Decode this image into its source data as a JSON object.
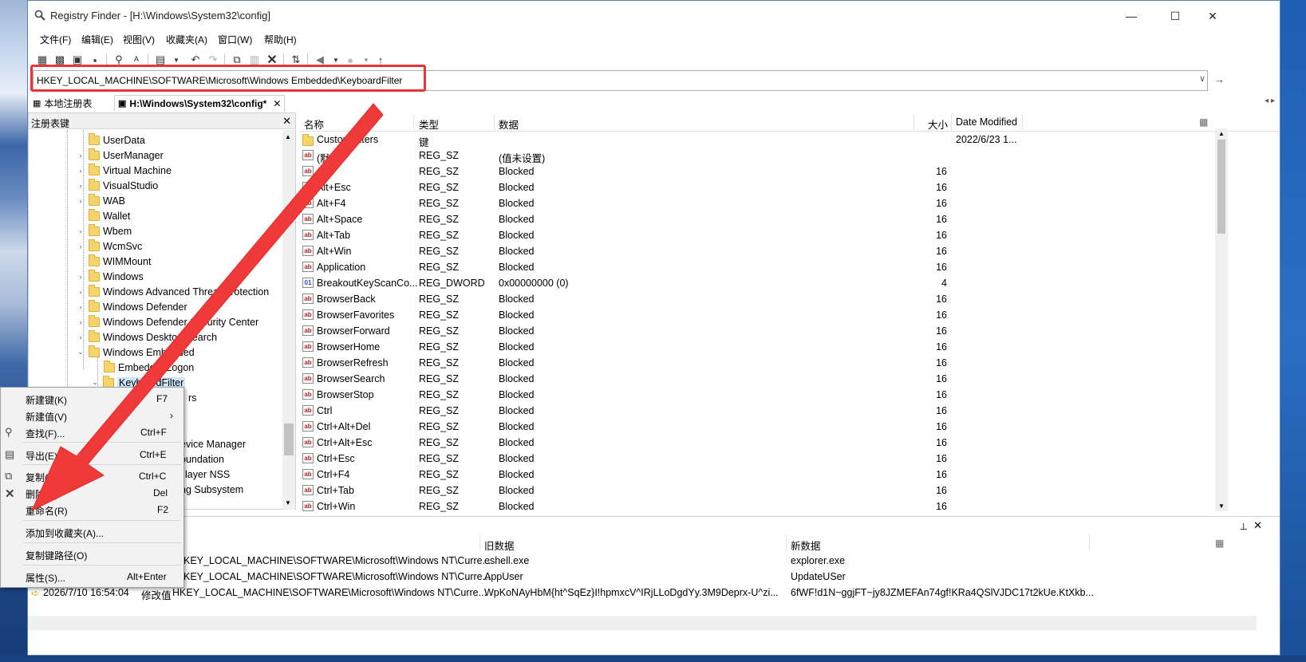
{
  "window": {
    "title": "Registry Finder - [H:\\Windows\\System32\\config]",
    "minimize": "—",
    "maximize": "☐",
    "close": "✕"
  },
  "menu": [
    "文件(F)",
    "编辑(E)",
    "视图(V)",
    "收藏夹(A)",
    "窗口(W)",
    "帮助(H)"
  ],
  "toolbar": {
    "icons": [
      "new-window-icon",
      "registry-icon",
      "hive-icon",
      "save-icon",
      "find-icon",
      "replace-icon",
      "export-icon",
      "undo-icon",
      "redo-icon",
      "copy-icon",
      "paste-icon",
      "delete-icon",
      "refresh-icon",
      "back-icon",
      "forward-icon",
      "up-icon"
    ]
  },
  "address": {
    "value": "HKEY_LOCAL_MACHINE\\SOFTWARE\\Microsoft\\Windows Embedded\\KeyboardFilter",
    "go": "→"
  },
  "doc_tabs": [
    {
      "label": "本地注册表"
    },
    {
      "label": "H:\\Windows\\System32\\config*"
    }
  ],
  "tree": {
    "header": "注册表键",
    "close": "✕",
    "items": [
      {
        "label": "UserData"
      },
      {
        "label": "UserManager"
      },
      {
        "label": "Virtual Machine"
      },
      {
        "label": "VisualStudio"
      },
      {
        "label": "WAB"
      },
      {
        "label": "Wallet"
      },
      {
        "label": "Wbem"
      },
      {
        "label": "WcmSvc"
      },
      {
        "label": "WIMMount"
      },
      {
        "label": "Windows"
      },
      {
        "label": "Windows Advanced Threat Protection"
      },
      {
        "label": "Windows Defender"
      },
      {
        "label": "Windows Defender Security Center"
      },
      {
        "label": "Windows Desktop Search"
      },
      {
        "label": "Windows Embedded"
      },
      {
        "label": "EmbeddedLogon"
      },
      {
        "label": "KeyboardFilter"
      },
      {
        "label": "rs"
      },
      {
        "label": "evice Manager"
      },
      {
        "label": "oundation"
      },
      {
        "label": "layer NSS"
      },
      {
        "label": "ng Subsystem"
      }
    ]
  },
  "list": {
    "columns": [
      "名称",
      "类型",
      "数据",
      "大小",
      "Date Modified"
    ],
    "rows": [
      {
        "name": "CustomFilters",
        "type": "键",
        "data": "",
        "size": "",
        "date": "2022/6/23 1...",
        "kind": "folder"
      },
      {
        "name": "(默认)",
        "type": "REG_SZ",
        "data": "(值未设置)",
        "size": "",
        "date": "",
        "kind": "sz"
      },
      {
        "name": "Alt",
        "type": "REG_SZ",
        "data": "Blocked",
        "size": "16",
        "date": "",
        "kind": "sz"
      },
      {
        "name": "Alt+Esc",
        "type": "REG_SZ",
        "data": "Blocked",
        "size": "16",
        "date": "",
        "kind": "sz"
      },
      {
        "name": "Alt+F4",
        "type": "REG_SZ",
        "data": "Blocked",
        "size": "16",
        "date": "",
        "kind": "sz"
      },
      {
        "name": "Alt+Space",
        "type": "REG_SZ",
        "data": "Blocked",
        "size": "16",
        "date": "",
        "kind": "sz"
      },
      {
        "name": "Alt+Tab",
        "type": "REG_SZ",
        "data": "Blocked",
        "size": "16",
        "date": "",
        "kind": "sz"
      },
      {
        "name": "Alt+Win",
        "type": "REG_SZ",
        "data": "Blocked",
        "size": "16",
        "date": "",
        "kind": "sz"
      },
      {
        "name": "Application",
        "type": "REG_SZ",
        "data": "Blocked",
        "size": "16",
        "date": "",
        "kind": "sz"
      },
      {
        "name": "BreakoutKeyScanCo...",
        "type": "REG_DWORD",
        "data": "0x00000000 (0)",
        "size": "4",
        "date": "",
        "kind": "dword"
      },
      {
        "name": "BrowserBack",
        "type": "REG_SZ",
        "data": "Blocked",
        "size": "16",
        "date": "",
        "kind": "sz"
      },
      {
        "name": "BrowserFavorites",
        "type": "REG_SZ",
        "data": "Blocked",
        "size": "16",
        "date": "",
        "kind": "sz"
      },
      {
        "name": "BrowserForward",
        "type": "REG_SZ",
        "data": "Blocked",
        "size": "16",
        "date": "",
        "kind": "sz"
      },
      {
        "name": "BrowserHome",
        "type": "REG_SZ",
        "data": "Blocked",
        "size": "16",
        "date": "",
        "kind": "sz"
      },
      {
        "name": "BrowserRefresh",
        "type": "REG_SZ",
        "data": "Blocked",
        "size": "16",
        "date": "",
        "kind": "sz"
      },
      {
        "name": "BrowserSearch",
        "type": "REG_SZ",
        "data": "Blocked",
        "size": "16",
        "date": "",
        "kind": "sz"
      },
      {
        "name": "BrowserStop",
        "type": "REG_SZ",
        "data": "Blocked",
        "size": "16",
        "date": "",
        "kind": "sz"
      },
      {
        "name": "Ctrl",
        "type": "REG_SZ",
        "data": "Blocked",
        "size": "16",
        "date": "",
        "kind": "sz"
      },
      {
        "name": "Ctrl+Alt+Del",
        "type": "REG_SZ",
        "data": "Blocked",
        "size": "16",
        "date": "",
        "kind": "sz"
      },
      {
        "name": "Ctrl+Alt+Esc",
        "type": "REG_SZ",
        "data": "Blocked",
        "size": "16",
        "date": "",
        "kind": "sz"
      },
      {
        "name": "Ctrl+Esc",
        "type": "REG_SZ",
        "data": "Blocked",
        "size": "16",
        "date": "",
        "kind": "sz"
      },
      {
        "name": "Ctrl+F4",
        "type": "REG_SZ",
        "data": "Blocked",
        "size": "16",
        "date": "",
        "kind": "sz"
      },
      {
        "name": "Ctrl+Tab",
        "type": "REG_SZ",
        "data": "Blocked",
        "size": "16",
        "date": "",
        "kind": "sz"
      },
      {
        "name": "Ctrl+Win",
        "type": "REG_SZ",
        "data": "Blocked",
        "size": "16",
        "date": "",
        "kind": "sz"
      }
    ]
  },
  "bottom": {
    "pin": "📌",
    "close": "✕",
    "columns": [
      "旧数据",
      "新数据"
    ],
    "rows": [
      {
        "time": "",
        "op": "",
        "key": "KEY_LOCAL_MACHINE\\SOFTWARE\\Microsoft\\Windows NT\\Curre...",
        "old": "eshell.exe",
        "new": "explorer.exe"
      },
      {
        "time": "",
        "op": "",
        "key": "KEY_LOCAL_MACHINE\\SOFTWARE\\Microsoft\\Windows NT\\Curre...",
        "old": "AppUser",
        "new": "UpdateUSer"
      },
      {
        "time": "2026/7/10 16:54:04",
        "op": "修改值",
        "key": "HKEY_LOCAL_MACHINE\\SOFTWARE\\Microsoft\\Windows NT\\Curre...",
        "old": "WpKoNAyHbM{ht^SqEz}I!hpmxcV^IRjLLoDgdYy.3M9Deprx-U^zi...",
        "new": "6fWF!d1N~ggjFT~jy8JZMEFAn74gf!KRa4QSlVJDC17t2kUe.KtXkb..."
      }
    ]
  },
  "context_menu": {
    "items": [
      {
        "label": "新建键(K)",
        "shortcut": "F7",
        "icon": ""
      },
      {
        "label": "新建值(V)",
        "shortcut": "",
        "icon": "",
        "submenu": "›"
      },
      {
        "label": "查找(F)...",
        "shortcut": "Ctrl+F",
        "icon": "find-icon"
      },
      {
        "label": "导出(E)...",
        "shortcut": "Ctrl+E",
        "icon": "export-icon"
      },
      {
        "label": "复制(C)",
        "shortcut": "Ctrl+C",
        "icon": "copy-icon"
      },
      {
        "label": "删除(D)",
        "shortcut": "Del",
        "icon": "delete-icon"
      },
      {
        "label": "重命名(R)",
        "shortcut": "F2",
        "icon": ""
      },
      {
        "label": "添加到收藏夹(A)...",
        "shortcut": "",
        "icon": ""
      },
      {
        "label": "复制键路径(O)",
        "shortcut": "",
        "icon": ""
      },
      {
        "label": "属性(S)...",
        "shortcut": "Alt+Enter",
        "icon": ""
      }
    ]
  },
  "colors": {
    "annotation_red": "#e83535",
    "folder_yellow": "#f7d46a",
    "selected_bg": "#cce8ff"
  }
}
